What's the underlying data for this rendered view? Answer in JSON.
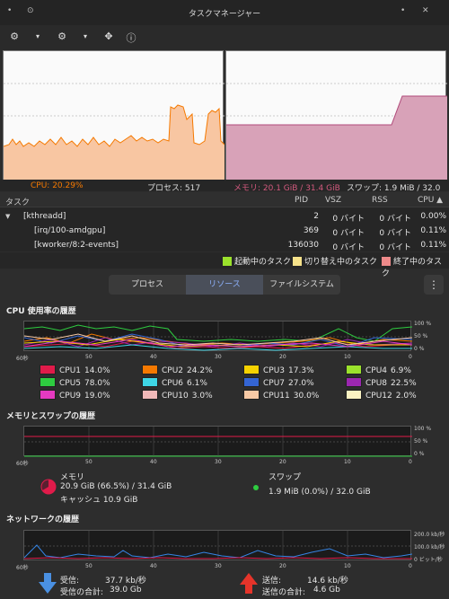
{
  "window": {
    "title": "タスクマネージャー"
  },
  "summary": {
    "cpu": "CPU: 20.29%",
    "processes": "プロセス: 517",
    "memory": "メモリ: 20.1 GiB / 31.4 GiB",
    "swap": "スワップ: 1.9 MiB / 32.0 GiB"
  },
  "table": {
    "headers": {
      "task": "タスク",
      "pid": "PID",
      "vsz": "VSZ",
      "rss": "RSS",
      "cpu": "CPU ▲"
    },
    "rows": [
      {
        "name": "[kthreadd]",
        "pid": "2",
        "vsz": "0 バイト",
        "rss": "0 バイト",
        "cpu": "0.00%",
        "indent": 0
      },
      {
        "name": "[irq/100-amdgpu]",
        "pid": "369",
        "vsz": "0 バイト",
        "rss": "0 バイト",
        "cpu": "0.11%",
        "indent": 1
      },
      {
        "name": "[kworker/8:2-events]",
        "pid": "136030",
        "vsz": "0 バイト",
        "rss": "0 バイト",
        "cpu": "0.11%",
        "indent": 1
      }
    ]
  },
  "legend": {
    "starting": "起動中のタスク",
    "switching": "切り替え中のタスク",
    "ending": "終了中のタスク"
  },
  "tabs": [
    "プロセス",
    "リソース",
    "ファイルシステム"
  ],
  "sections": {
    "cpu": "CPU 使用率の履歴",
    "mem": "メモリとスワップの履歴",
    "net": "ネットワークの履歴"
  },
  "axes": {
    "time": [
      "60秒",
      "50",
      "40",
      "30",
      "20",
      "10",
      "0"
    ],
    "cpu_y": [
      "100 %",
      "50 %",
      "0 %"
    ],
    "mem_y": [
      "100 %",
      "50 %",
      "0 %"
    ],
    "net_y": [
      "200.0 kb/秒",
      "100.0 kb/秒",
      "0 ビット/秒"
    ]
  },
  "cpus": [
    {
      "name": "CPU1",
      "value": "14.0%",
      "color": "#e01b4a"
    },
    {
      "name": "CPU2",
      "value": "24.2%",
      "color": "#f57900"
    },
    {
      "name": "CPU3",
      "value": "17.3%",
      "color": "#f6d200"
    },
    {
      "name": "CPU4",
      "value": "6.9%",
      "color": "#9be22c"
    },
    {
      "name": "CPU5",
      "value": "78.0%",
      "color": "#2ecc40"
    },
    {
      "name": "CPU6",
      "value": "6.1%",
      "color": "#3ed6e6"
    },
    {
      "name": "CPU7",
      "value": "27.0%",
      "color": "#3465d4"
    },
    {
      "name": "CPU8",
      "value": "22.5%",
      "color": "#9b27b0"
    },
    {
      "name": "CPU9",
      "value": "19.0%",
      "color": "#e53ac0"
    },
    {
      "name": "CPU10",
      "value": "3.0%",
      "color": "#f0b8b8"
    },
    {
      "name": "CPU11",
      "value": "30.0%",
      "color": "#f7c9a5"
    },
    {
      "name": "CPU12",
      "value": "2.0%",
      "color": "#fbf2c2"
    }
  ],
  "memory": {
    "label": "メモリ",
    "usage": "20.9 GiB (66.5%) / 31.4 GiB",
    "cache": "キャッシュ 10.9 GiB",
    "fraction": 0.665
  },
  "swap": {
    "label": "スワップ",
    "usage": "1.9 MiB (0.0%) / 32.0 GiB"
  },
  "network": {
    "recv_label": "受信:",
    "recv_rate": "37.7 kb/秒",
    "recv_total_label": "受信の合計:",
    "recv_total": "39.0 Gb",
    "send_label": "送信:",
    "send_rate": "14.6 kb/秒",
    "send_total_label": "送信の合計:",
    "send_total": "4.6 Gb"
  },
  "colors": {
    "accent_cpu": "#f57900",
    "mem_fill": "#d8a2b8",
    "mem_red": "#e01b4a"
  }
}
